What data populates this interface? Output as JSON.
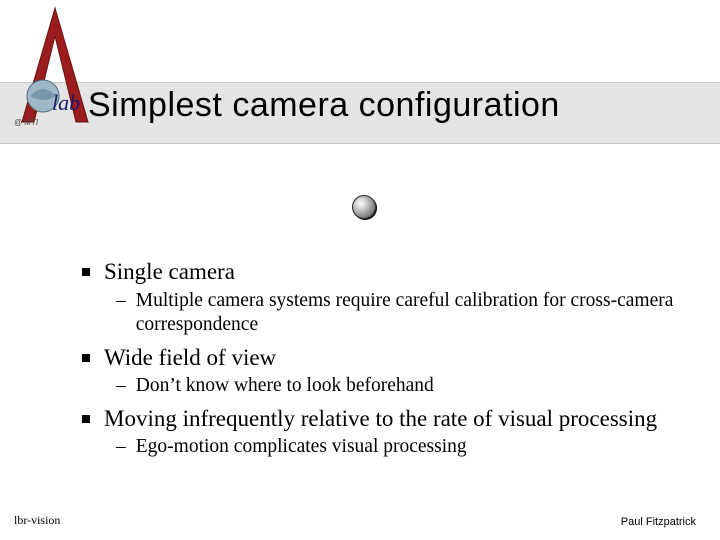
{
  "title": "Simplest camera configuration",
  "logo": {
    "tag": "@ MTI",
    "word": "lab"
  },
  "bullets": [
    {
      "text": "Single camera",
      "subs": [
        "Multiple camera systems require careful calibration for cross-camera correspondence"
      ]
    },
    {
      "text": "Wide field of view",
      "subs": [
        "Don’t know where to look beforehand"
      ]
    },
    {
      "text": "Moving infrequently relative to the rate of visual processing",
      "subs": [
        "Ego-motion complicates visual processing"
      ]
    }
  ],
  "footer": {
    "left": "lbr-vision",
    "right": "Paul Fitzpatrick"
  }
}
